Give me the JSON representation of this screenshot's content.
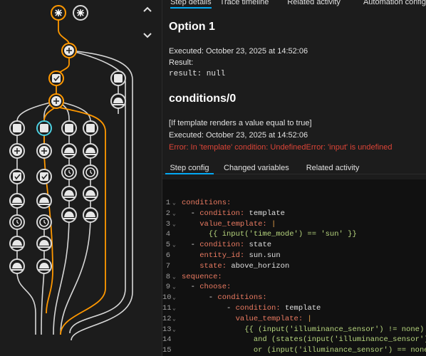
{
  "graph": {
    "collapse_label": "collapse",
    "expand_label": "expand",
    "accent": "#ff9800",
    "highlight": "#4dd0e1"
  },
  "top_tabs": [
    "Step details",
    "Trace timeline",
    "Related activity",
    "Automation config"
  ],
  "option": {
    "title": "Option 1",
    "executed": "Executed: October 23, 2025 at 14:52:06",
    "result_label": "Result:",
    "result_value": "result: null"
  },
  "condition": {
    "title": "conditions/0",
    "description": "[If template renders a value equal to true]",
    "executed": "Executed: October 23, 2025 at 14:52:06",
    "error": "Error: In 'template' condition: UndefinedError: 'input' is undefined"
  },
  "bottom_tabs": [
    "Step config",
    "Changed variables",
    "Related activity"
  ],
  "code": [
    {
      "n": "1",
      "f": "⌄",
      "t": [
        [
          "k",
          "conditions:"
        ]
      ]
    },
    {
      "n": "2",
      "f": "⌄",
      "t": [
        [
          "v",
          "  - "
        ],
        [
          "k",
          "condition:"
        ],
        [
          "v",
          " template"
        ]
      ]
    },
    {
      "n": "3",
      "f": "⌄",
      "t": [
        [
          "v",
          "    "
        ],
        [
          "k",
          "value_template:"
        ],
        [
          "v",
          " "
        ],
        [
          "p",
          "|"
        ]
      ]
    },
    {
      "n": "4",
      "f": "",
      "t": [
        [
          "s",
          "      {{ input('time_mode') == 'sun' }}"
        ]
      ]
    },
    {
      "n": "5",
      "f": "⌄",
      "t": [
        [
          "v",
          "  - "
        ],
        [
          "k",
          "condition:"
        ],
        [
          "v",
          " state"
        ]
      ]
    },
    {
      "n": "6",
      "f": "",
      "t": [
        [
          "v",
          "    "
        ],
        [
          "k",
          "entity_id:"
        ],
        [
          "v",
          " sun.sun"
        ]
      ]
    },
    {
      "n": "7",
      "f": "",
      "t": [
        [
          "v",
          "    "
        ],
        [
          "k",
          "state:"
        ],
        [
          "v",
          " above_horizon"
        ]
      ]
    },
    {
      "n": "8",
      "f": "⌄",
      "t": [
        [
          "k",
          "sequence:"
        ]
      ]
    },
    {
      "n": "9",
      "f": "⌄",
      "t": [
        [
          "v",
          "  - "
        ],
        [
          "k",
          "choose:"
        ]
      ]
    },
    {
      "n": "10",
      "f": "⌄",
      "t": [
        [
          "v",
          "      - "
        ],
        [
          "k",
          "conditions:"
        ]
      ]
    },
    {
      "n": "11",
      "f": "⌄",
      "t": [
        [
          "v",
          "          - "
        ],
        [
          "k",
          "condition:"
        ],
        [
          "v",
          " template"
        ]
      ]
    },
    {
      "n": "12",
      "f": "⌄",
      "t": [
        [
          "v",
          "            "
        ],
        [
          "k",
          "value_template:"
        ],
        [
          "v",
          " "
        ],
        [
          "p",
          "|"
        ]
      ]
    },
    {
      "n": "13",
      "f": "⌄",
      "t": [
        [
          "s",
          "              {{ (input('illuminance_sensor') != none)"
        ]
      ]
    },
    {
      "n": "14",
      "f": "",
      "t": [
        [
          "s",
          "                and (states(input('illuminance_sensor'))|int"
        ]
      ]
    },
    {
      "n": "15",
      "f": "",
      "t": [
        [
          "s",
          "                or (input('illuminance_sensor') == none) }}"
        ]
      ]
    }
  ]
}
